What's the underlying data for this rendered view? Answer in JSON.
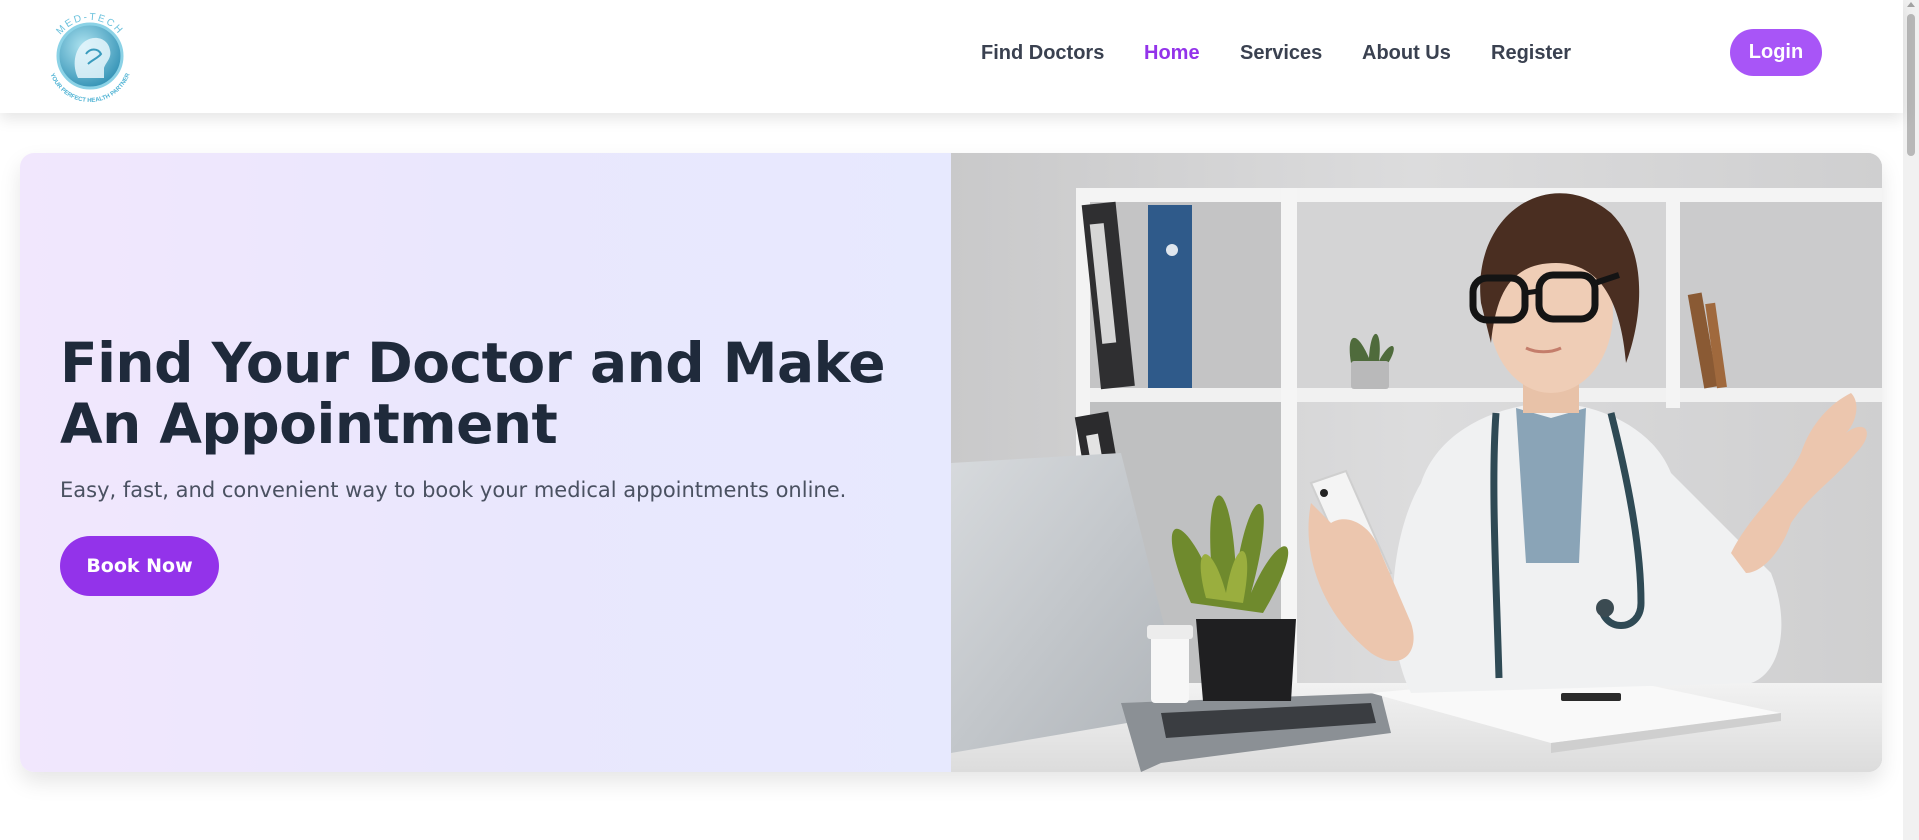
{
  "header": {
    "logo": {
      "top_text": "MED-TECH",
      "bottom_text": "YOUR PERFECT HEALTH PARTNER",
      "icon": "medical-head-logo-icon"
    },
    "nav": [
      {
        "label": "Find Doctors",
        "active": false
      },
      {
        "label": "Home",
        "active": true
      },
      {
        "label": "Services",
        "active": false
      },
      {
        "label": "About Us",
        "active": false
      },
      {
        "label": "Register",
        "active": false
      }
    ],
    "login_label": "Login"
  },
  "hero": {
    "title": "Find Your Doctor and Make An Appointment",
    "subtitle": "Easy, fast, and convenient way to book your medical appointments online.",
    "cta_label": "Book Now",
    "image_icon": "doctor-with-phone-photo"
  },
  "colors": {
    "accent": "#9333ea",
    "login_bg": "#a855f7",
    "heading": "#1f2a3b",
    "logo_teal": "#5bb8d6"
  }
}
